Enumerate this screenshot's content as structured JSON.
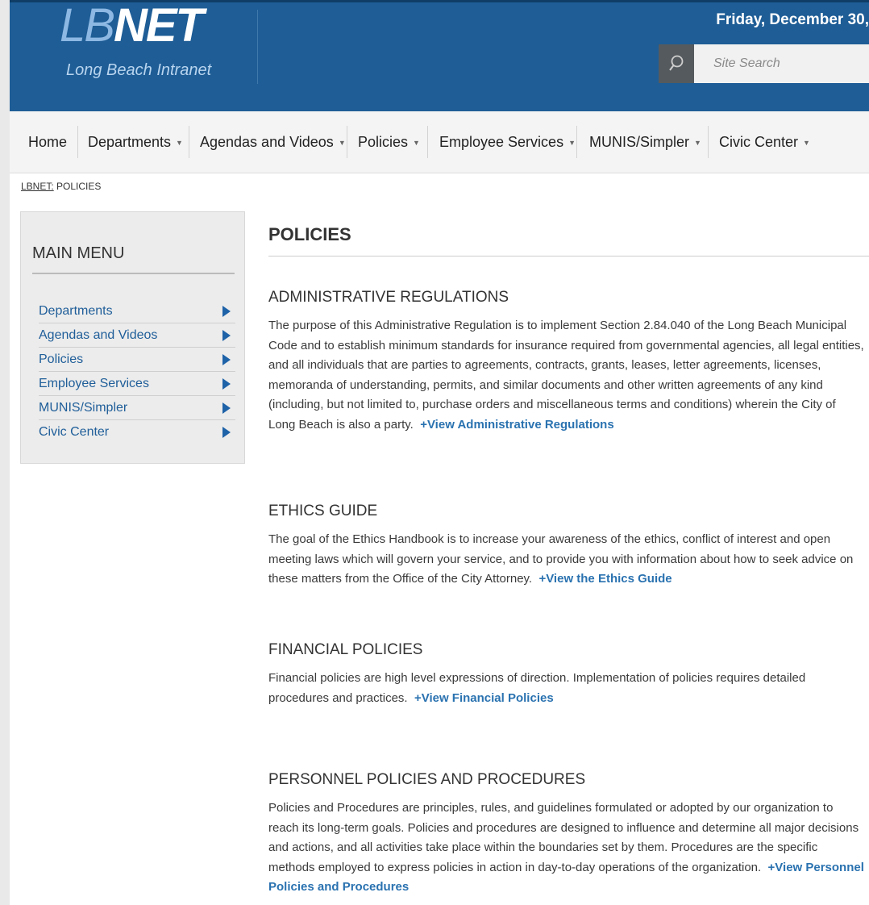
{
  "header": {
    "logo_lb": "LB",
    "logo_net": "NET",
    "logo_subtitle": "Long Beach Intranet",
    "date": "Friday, December 30,",
    "search_placeholder": "Site Search",
    "search_icon": "search-icon",
    "colors": {
      "header_bg": "#1e5d96",
      "link": "#2a72b0"
    }
  },
  "nav": {
    "items": [
      {
        "label": "Home",
        "has_dropdown": false
      },
      {
        "label": "Departments",
        "has_dropdown": true
      },
      {
        "label": "Agendas and Videos",
        "has_dropdown": true
      },
      {
        "label": "Policies",
        "has_dropdown": true
      },
      {
        "label": "Employee Services",
        "has_dropdown": true
      },
      {
        "label": "MUNIS/Simpler",
        "has_dropdown": true
      },
      {
        "label": "Civic Center",
        "has_dropdown": true
      }
    ],
    "caret_icon": "chevron-down-icon"
  },
  "breadcrumb": {
    "root": "LBNET:",
    "current": "POLICIES"
  },
  "sidebar": {
    "title": "MAIN MENU",
    "items": [
      {
        "label": "Departments"
      },
      {
        "label": "Agendas and Videos"
      },
      {
        "label": "Policies"
      },
      {
        "label": "Employee Services"
      },
      {
        "label": "MUNIS/Simpler"
      },
      {
        "label": "Civic Center"
      }
    ],
    "arrow_icon": "triangle-right-icon"
  },
  "main": {
    "title": "POLICIES",
    "sections": [
      {
        "heading": "ADMINISTRATIVE REGULATIONS",
        "body": "The purpose of this Administrative Regulation is to implement Section 2.84.040 of the Long Beach Municipal Code and to establish minimum standards for insurance required from governmental agencies, all legal entities, and all individuals that are parties to agreements, contracts, grants, leases, letter agreements, licenses, memoranda of understanding, permits, and similar documents and other written agreements of any kind (including, but not limited to, purchase orders and miscellaneous terms and conditions) wherein the City of Long Beach is also a party.",
        "link": "+View Administrative Regulations"
      },
      {
        "heading": "ETHICS GUIDE",
        "body": "The goal of the Ethics Handbook is to increase your awareness of the ethics, conflict of interest and open meeting laws which will govern your service, and to provide you with information about how to seek advice on these matters from the Office of the City Attorney.",
        "link": "+View the Ethics Guide"
      },
      {
        "heading": "FINANCIAL POLICIES",
        "body": "Financial policies are high level expressions of direction. Implementation of policies requires detailed procedures and practices.",
        "link": "+View Financial Policies"
      },
      {
        "heading": "PERSONNEL POLICIES AND PROCEDURES",
        "body": "Policies and Procedures are principles, rules, and guidelines formulated or adopted by our organization to reach its long-term goals. Policies and procedures are designed to influence and determine all major decisions and actions, and all activities take place within the boundaries set by them. Procedures are the specific methods employed to express policies in action in day-to-day operations of the organization.",
        "link": "+View Personnel Policies and Procedures"
      }
    ]
  }
}
